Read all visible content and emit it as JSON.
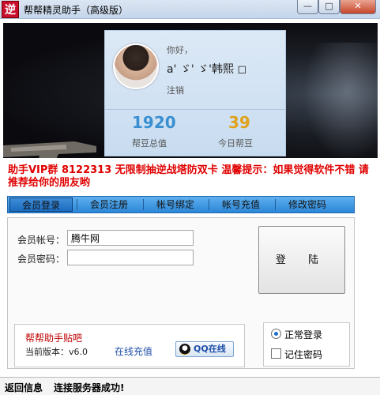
{
  "window": {
    "icon_char": "逆",
    "title": "帮帮精灵助手（高级版）",
    "min_glyph": "—",
    "max_glyph": "□",
    "close_glyph": "✕"
  },
  "profile": {
    "greeting": "你好，",
    "username": "a' ゞ' ゞ'韩熙 ◻",
    "logout": "注销",
    "total_points_value": "1920",
    "total_points_label": "帮豆总值",
    "today_points_value": "39",
    "today_points_label": "今日帮豆"
  },
  "notice": "助手VIP群 8122313 无限制抽逆战塔防双卡 温馨提示：如果觉得软件不错 请推荐给你的朋友哟",
  "tabs": [
    "会员登录",
    "会员注册",
    "帐号绑定",
    "帐号充值",
    "修改密码"
  ],
  "login": {
    "account_label": "会员帐号：",
    "account_value": "腾牛网",
    "password_label": "会员密码：",
    "password_value": "",
    "login_button": "登 陆"
  },
  "info": {
    "help_link": "帮帮助手贴吧",
    "version_text": "当前版本：v6.0",
    "recharge_link": "在线充值",
    "qq_button": "QQ在线"
  },
  "mode": {
    "normal_login": "正常登录",
    "remember_password": "记住密码"
  },
  "status": {
    "label": "返回信息",
    "message": "连接服务器成功!"
  }
}
